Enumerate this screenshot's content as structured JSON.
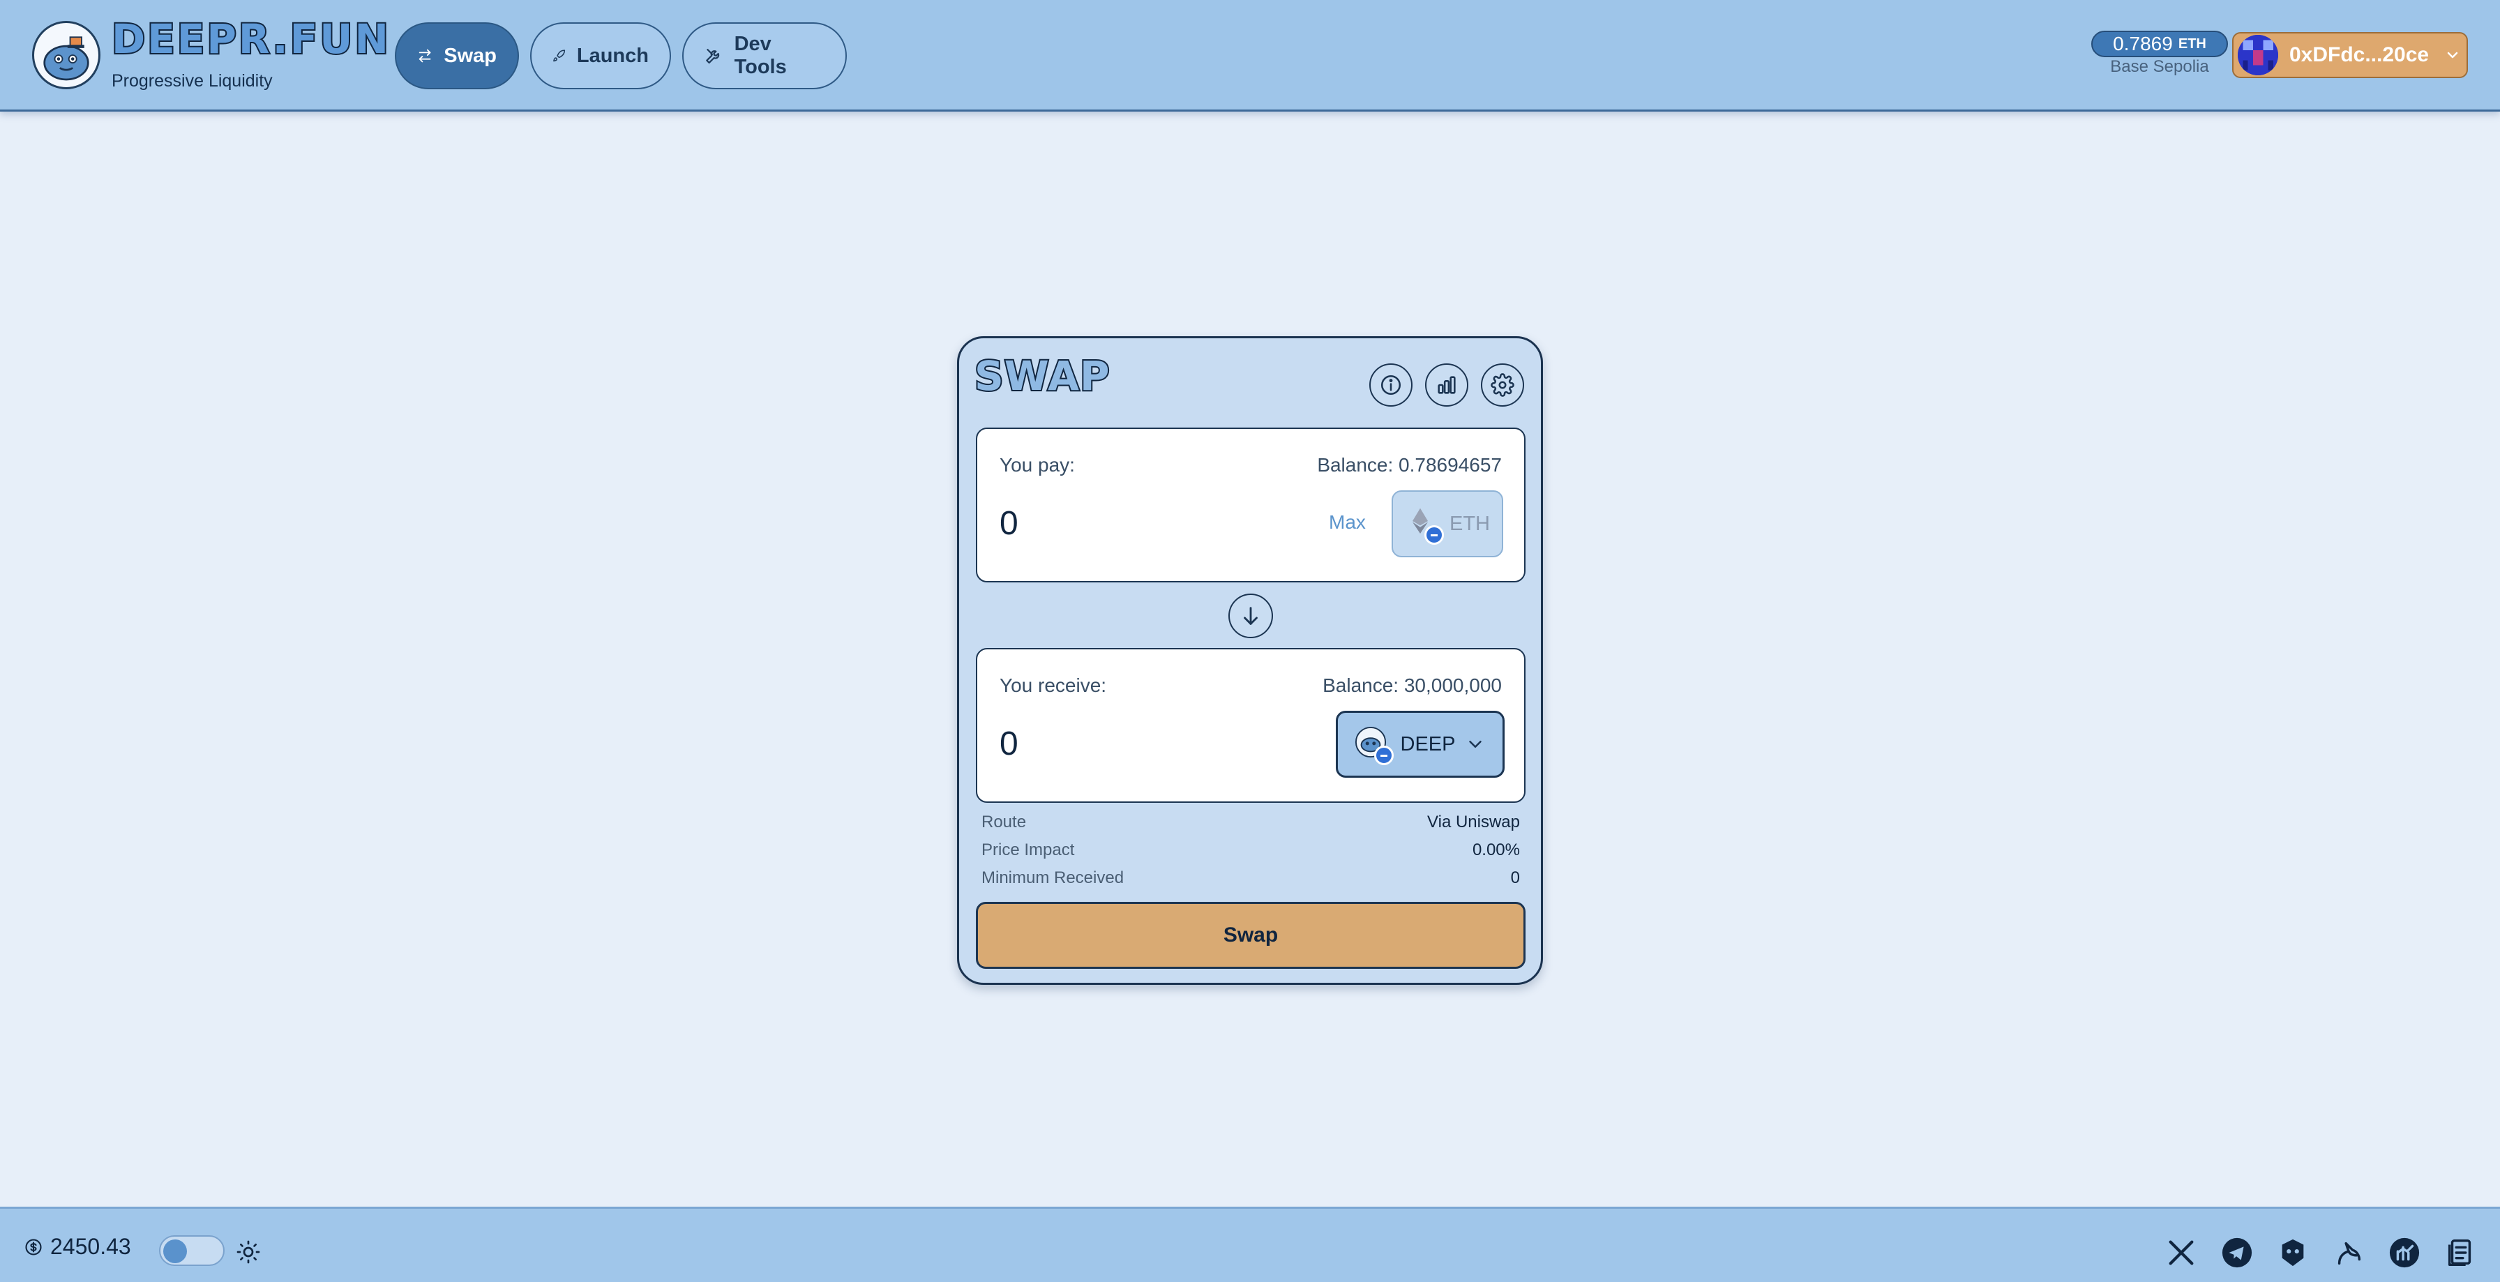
{
  "header": {
    "logo_title": "DEEPR.FUN",
    "logo_subtitle": "Progressive Liquidity",
    "nav": [
      {
        "label": "Swap",
        "icon": "swap-arrows-icon",
        "active": true
      },
      {
        "label": "Launch",
        "icon": "rocket-icon",
        "active": false
      },
      {
        "label": "Dev Tools",
        "icon": "tools-icon",
        "active": false
      }
    ],
    "eth_balance": "0.7869",
    "eth_unit": "ETH",
    "network": "Base Sepolia",
    "wallet_address": "0xDFdc...20ce"
  },
  "swap": {
    "title": "SWAP",
    "pay": {
      "label": "You pay:",
      "balance": "Balance: 0.78694657",
      "amount": "0",
      "max_label": "Max",
      "token": "ETH"
    },
    "receive": {
      "label": "You receive:",
      "balance": "Balance: 30,000,000",
      "amount": "0",
      "token": "DEEP"
    },
    "details": [
      {
        "key": "Route",
        "value": "Via Uniswap"
      },
      {
        "key": "Price Impact",
        "value": "0.00%"
      },
      {
        "key": "Minimum Received",
        "value": "0"
      }
    ],
    "button_label": "Swap"
  },
  "footer": {
    "eth_price": "2450.43",
    "theme_toggle_on": false
  },
  "colors": {
    "background": "#e7eff9",
    "header": "#9ec5e9",
    "active_nav": "#3a6fa5",
    "wallet": "#dea86e",
    "swap_button": "#d9aa73",
    "card": "#c8dcf2"
  }
}
